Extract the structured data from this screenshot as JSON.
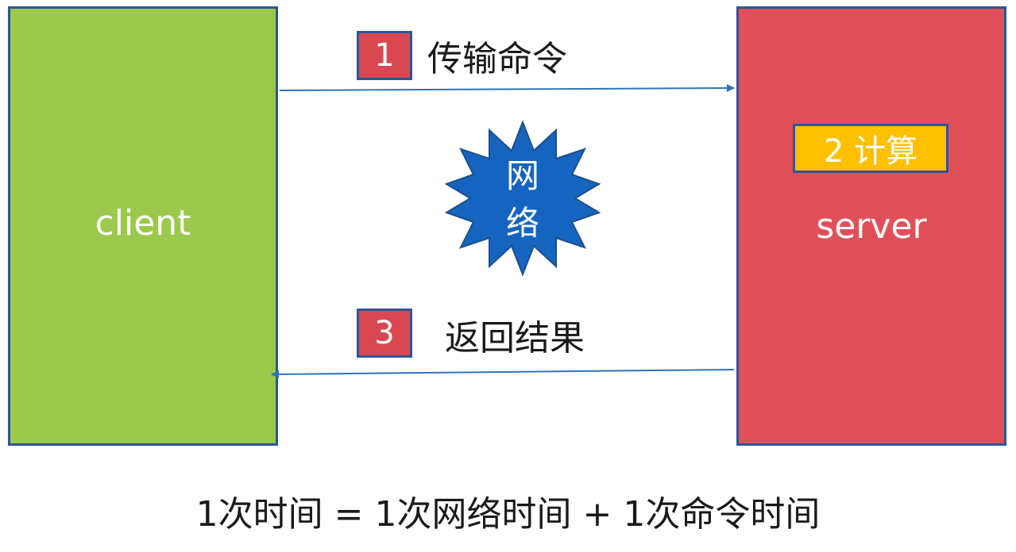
{
  "client": {
    "label": "client"
  },
  "server": {
    "label": "server"
  },
  "step1": {
    "number": "1",
    "text": "传输命令"
  },
  "step2": {
    "label": "2 计算"
  },
  "step3": {
    "number": "3",
    "text": "返回结果"
  },
  "network": {
    "line1": "网",
    "line2": "络"
  },
  "formula": "1次时间 = 1次网络时间 + 1次命令时间",
  "colors": {
    "client_fill": "#9bc94b",
    "server_fill": "#e0505a",
    "border": "#2e5597",
    "compute_fill": "#ffc000",
    "network_fill": "#1565c0",
    "arrow": "#2e75b6"
  }
}
